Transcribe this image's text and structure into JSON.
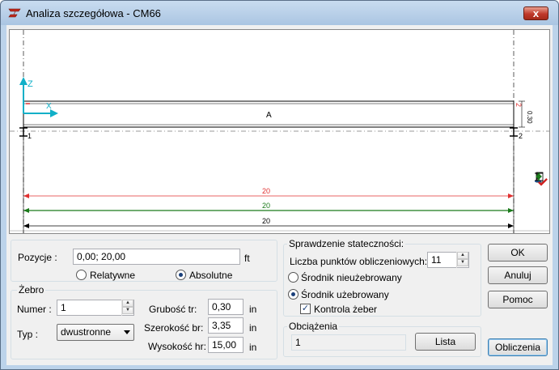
{
  "window": {
    "title": "Analiza szczegółowa - CM66",
    "close_label": "x"
  },
  "drawing": {
    "axis_z": "Z",
    "axis_x": "X",
    "member_label": "A",
    "node_left": "1",
    "node_right": "2",
    "node_right_top": "2",
    "depth_dim": "0.30",
    "dim_red": "20",
    "dim_green": "20",
    "dim_black": "20",
    "colors": {
      "red": "#e03030",
      "green": "#1a7a1a",
      "cyan": "#10b0c8"
    }
  },
  "positions": {
    "label": "Pozycje :",
    "value": "0,00; 20,00",
    "unit": "ft",
    "relative_label": "Relatywne",
    "absolute_label": "Absolutne",
    "selected": "absolute"
  },
  "rib": {
    "group_label": "Żebro",
    "number_label": "Numer :",
    "number_value": "1",
    "type_label": "Typ :",
    "type_value": "dwustronne",
    "thickness_label": "Grubość tr:",
    "thickness_value": "0,30",
    "thickness_unit": "in",
    "width_label": "Szerokość br:",
    "width_value": "3,35",
    "width_unit": "in",
    "height_label": "Wysokość hr:",
    "height_value": "15,00",
    "height_unit": "in"
  },
  "stability": {
    "group_label": "Sprawdzenie stateczności:",
    "points_label": "Liczba punktów obliczeniowych:",
    "points_value": "11",
    "unstiffened_label": "Środnik nieużebrowany",
    "stiffened_label": "Środnik użebrowany",
    "rib_control_label": "Kontrola żeber",
    "selected": "stiffened",
    "rib_control_checked": true
  },
  "loads": {
    "group_label": "Obciążenia",
    "value": "1",
    "list_button": "Lista"
  },
  "buttons": {
    "ok": "OK",
    "cancel": "Anuluj",
    "help": "Pomoc",
    "calculate": "Obliczenia"
  }
}
